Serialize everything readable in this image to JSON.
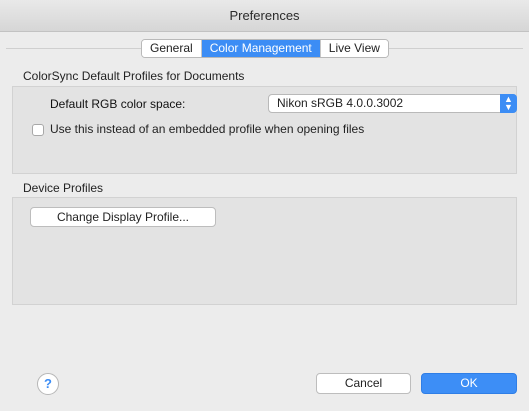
{
  "window": {
    "title": "Preferences"
  },
  "tabs": [
    {
      "label": "General",
      "active": false
    },
    {
      "label": "Color Management",
      "active": true
    },
    {
      "label": "Live View",
      "active": false
    }
  ],
  "colorsync": {
    "section_title": "ColorSync Default Profiles for Documents",
    "rgb_label": "Default RGB color space:",
    "rgb_value": "Nikon sRGB 4.0.0.3002",
    "checkbox_label": "Use this instead of an embedded profile when opening files",
    "checkbox_checked": false
  },
  "device": {
    "section_title": "Device Profiles",
    "change_display_button": "Change Display Profile..."
  },
  "footer": {
    "help_symbol": "?",
    "cancel_label": "Cancel",
    "ok_label": "OK"
  },
  "colors": {
    "accent": "#3c8df5",
    "window_bg": "#ececec",
    "group_bg": "#e3e3e3"
  }
}
